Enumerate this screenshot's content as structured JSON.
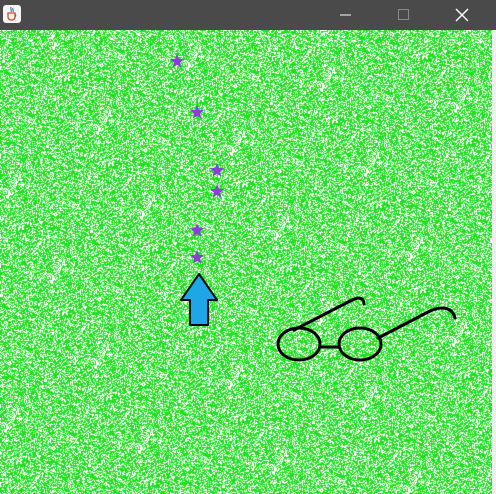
{
  "window": {
    "title": "",
    "app_icon": "java-cup-icon",
    "controls": [
      "minimize-icon",
      "maximize-icon",
      "close-icon"
    ],
    "titlebar_color": "#4a4a4a"
  },
  "playfield": {
    "background": "grass",
    "grass_color": "#22dd22",
    "base_color": "#ffffff"
  },
  "player": {
    "icon": "arrow-up-icon",
    "direction": "up",
    "fill_color": "#1ea7e8",
    "stroke_color": "#0a0a0a"
  },
  "trail": {
    "icon": "star-icon",
    "color": "#8b3fd6",
    "count": 6
  },
  "item": {
    "icon": "glasses-icon",
    "color": "#000000"
  }
}
